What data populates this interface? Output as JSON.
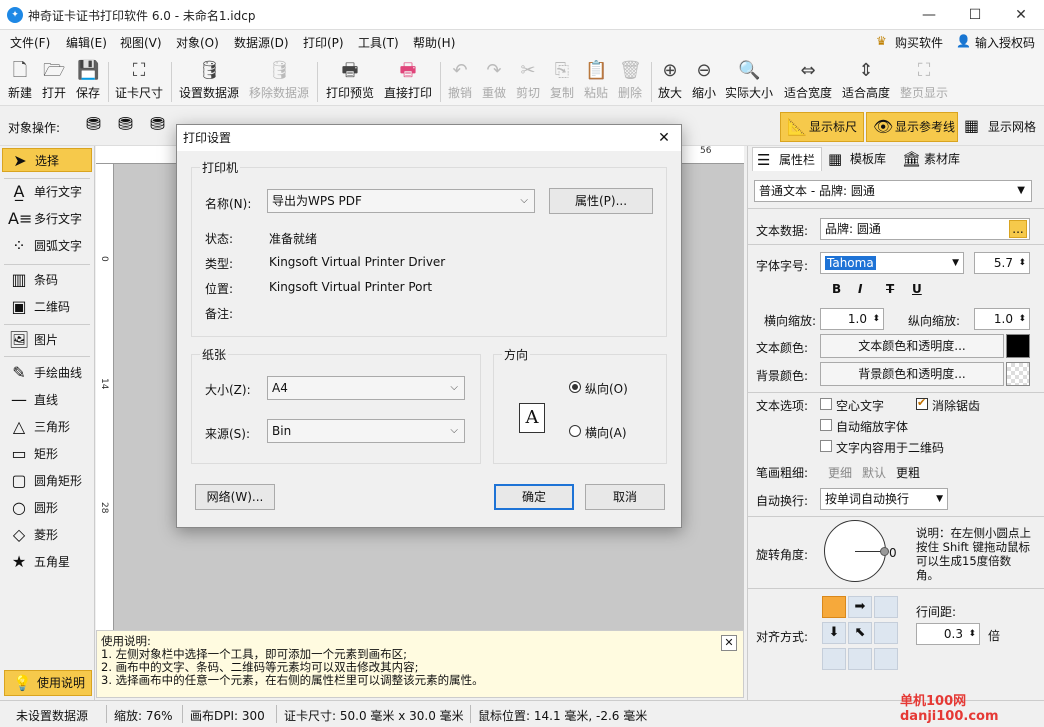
{
  "window": {
    "title": "神奇证卡证书打印软件 6.0 - 未命名1.idcp"
  },
  "menu": [
    "文件(F)",
    "编辑(E)",
    "视图(V)",
    "对象(O)",
    "数据源(D)",
    "打印(P)",
    "工具(T)",
    "帮助(H)"
  ],
  "menu_right": {
    "buy": "购买软件",
    "license": "输入授权码"
  },
  "toolbar": [
    {
      "label": "新建",
      "icon": "new-file-icon"
    },
    {
      "label": "打开",
      "icon": "open-folder-icon"
    },
    {
      "label": "保存",
      "icon": "save-icon"
    },
    {
      "label": "证卡尺寸",
      "icon": "card-size-icon"
    },
    {
      "label": "设置数据源",
      "icon": "database-icon"
    },
    {
      "label": "移除数据源",
      "icon": "remove-database-icon"
    },
    {
      "label": "打印预览",
      "icon": "print-preview-icon"
    },
    {
      "label": "直接打印",
      "icon": "printer-icon"
    },
    {
      "label": "撤销",
      "icon": "undo-icon"
    },
    {
      "label": "重做",
      "icon": "redo-icon"
    },
    {
      "label": "剪切",
      "icon": "cut-icon"
    },
    {
      "label": "复制",
      "icon": "copy-icon"
    },
    {
      "label": "粘贴",
      "icon": "paste-icon"
    },
    {
      "label": "删除",
      "icon": "delete-icon"
    },
    {
      "label": "放大",
      "icon": "zoom-in-icon"
    },
    {
      "label": "缩小",
      "icon": "zoom-out-icon"
    },
    {
      "label": "实际大小",
      "icon": "actual-size-icon"
    },
    {
      "label": "适合宽度",
      "icon": "fit-width-icon"
    },
    {
      "label": "适合高度",
      "icon": "fit-height-icon"
    },
    {
      "label": "整页显示",
      "icon": "full-page-icon"
    }
  ],
  "ops_row": {
    "label": "对象操作:",
    "show_ruler": "显示标尺",
    "show_guides": "显示参考线",
    "show_grid": "显示网格"
  },
  "tools": [
    "选择",
    "单行文字",
    "多行文字",
    "圆弧文字",
    "条码",
    "二维码",
    "图片",
    "手绘曲线",
    "直线",
    "三角形",
    "矩形",
    "圆角矩形",
    "圆形",
    "菱形",
    "五角星"
  ],
  "help_button": "使用说明",
  "ruler": {
    "h_label": "56",
    "v_labels": [
      "0",
      "14",
      "28"
    ]
  },
  "usage": {
    "title": "使用说明:",
    "lines": [
      "1. 左侧对象栏中选择一个工具，即可添加一个元素到画布区;",
      "2. 画布中的文字、条码、二维码等元素均可以双击修改其内容;",
      "3. 选择画布中的任意一个元素，在右侧的属性栏里可以调整该元素的属性。"
    ]
  },
  "status": {
    "datasource": "未设置数据源",
    "zoom": "缩放: 76%",
    "dpi": "画布DPI: 300",
    "card_size": "证卡尺寸: 50.0 毫米 x 30.0 毫米",
    "mouse_pos": "鼠标位置: 14.1 毫米, -2.6 毫米"
  },
  "rpanel": {
    "tabs": [
      "属性栏",
      "模板库",
      "素材库"
    ],
    "element_select": "普通文本 - 品牌: 圆通",
    "text_data_label": "文本数据:",
    "text_data_value": "品牌: 圆通",
    "text_data_btn": "...",
    "font_label": "字体字号:",
    "font_name": "Tahoma",
    "font_size": "5.7",
    "style_buttons": [
      "B",
      "I",
      "T",
      "U"
    ],
    "hscale_label": "横向缩放:",
    "hscale_value": "1.0",
    "vscale_label": "纵向缩放:",
    "vscale_value": "1.0",
    "text_color_label": "文本颜色:",
    "text_color_btn": "文本颜色和透明度...",
    "bg_color_label": "背景颜色:",
    "bg_color_btn": "背景颜色和透明度...",
    "text_opts_label": "文本选项:",
    "opt_hollow": "空心文字",
    "opt_antialias": "消除锯齿",
    "opt_autoscale": "自动缩放字体",
    "opt_qr": "文字内容用于二维码",
    "stroke_label": "笔画粗细:",
    "stroke_thin": "更细",
    "stroke_default": "默认",
    "stroke_bold": "更粗",
    "wrap_label": "自动换行:",
    "wrap_value": "按单词自动换行",
    "rotate_label": "旋转角度:",
    "rotate_value": "0",
    "rotate_note": "说明：在左侧小圆点上按住 Shift 键拖动鼠标可以生成15度倍数角。",
    "align_label": "对齐方式:",
    "linespacing_label": "行间距:",
    "linespacing_value": "0.3",
    "linespacing_unit": "倍"
  },
  "dialog": {
    "title": "打印设置",
    "printer_group": "打印机",
    "name_label": "名称(N):",
    "name_value": "导出为WPS PDF",
    "props_btn": "属性(P)...",
    "status_label": "状态:",
    "status_value": "准备就绪",
    "type_label": "类型:",
    "type_value": "Kingsoft Virtual Printer Driver",
    "where_label": "位置:",
    "where_value": "Kingsoft Virtual Printer Port",
    "comment_label": "备注:",
    "paper_group": "纸张",
    "size_label": "大小(Z):",
    "size_value": "A4",
    "source_label": "来源(S):",
    "source_value": "Bin",
    "orient_group": "方向",
    "portrait": "纵向(O)",
    "landscape": "横向(A)",
    "network_btn": "网络(W)...",
    "ok_btn": "确定",
    "cancel_btn": "取消"
  },
  "watermark": "单机100网 danji100.com"
}
